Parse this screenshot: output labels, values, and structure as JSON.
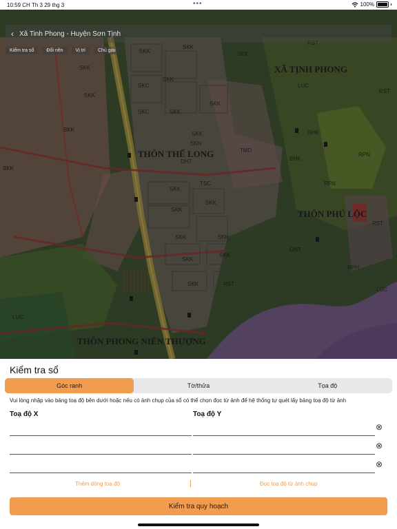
{
  "status_bar": {
    "time": "10:59 CH",
    "date": "Th 3 29 thg 3",
    "dots": "•••",
    "battery": "100%"
  },
  "map": {
    "header_title": "Xã Tinh Phong - Huyện Sơn Tịnh",
    "tabs": [
      "Kiểm tra sổ",
      "Đổi nền",
      "Vị trí",
      "Chú giải"
    ],
    "place_names": [
      "XÃ TỊNH PHONG",
      "THÔN THẾ LONG",
      "THÔN PHÚ LỘC",
      "THÔN PHONG NIÊN THƯỢNG"
    ],
    "zone_codes": [
      "SKK",
      "SKK",
      "SKK",
      "SKC",
      "SKC",
      "SKK",
      "SKK",
      "SKK",
      "SKK",
      "SKK",
      "SKK",
      "RST",
      "LUC",
      "RST",
      "BHK",
      "BHK",
      "RPN",
      "RPN",
      "RST",
      "RPH",
      "LUC",
      "SKK",
      "SKN",
      "DHT",
      "ONT",
      "TSC",
      "TMD",
      "SKK",
      "SKK",
      "SKK",
      "SKK",
      "SKK",
      "SKK",
      "SKK",
      "SKK",
      "LUC",
      "RST",
      "SKK"
    ],
    "colors": {
      "land_green": "#4d6b3a",
      "river_purple": "#9d6fb5",
      "road_yellow": "#c8b04a",
      "boundary_red": "#c73232"
    }
  },
  "sheet": {
    "title": "Kiểm tra sổ",
    "tabs": [
      {
        "label": "Góc ranh",
        "active": true
      },
      {
        "label": "Tờ/thửa",
        "active": false
      },
      {
        "label": "Tọa độ",
        "active": false
      }
    ],
    "hint": "Vui lòng nhập vào bảng toạ độ bên dưới hoặc nếu có ảnh chụp của sổ có thể chọn đọc từ ảnh để hệ thống tự quét lấy bảng toạ độ từ ảnh",
    "col_x": "Toạ độ X",
    "col_y": "Toạ độ Y",
    "rows": [
      {
        "x": "",
        "y": ""
      },
      {
        "x": "",
        "y": ""
      },
      {
        "x": "",
        "y": ""
      }
    ],
    "clear_icon": "⊗",
    "add_row_label": "Thêm dòng toạ độ",
    "read_photo_label": "Đọc toạ độ từ ảnh chụp",
    "submit_label": "Kiểm tra quy hoạch",
    "accent": "#f19c4e"
  }
}
